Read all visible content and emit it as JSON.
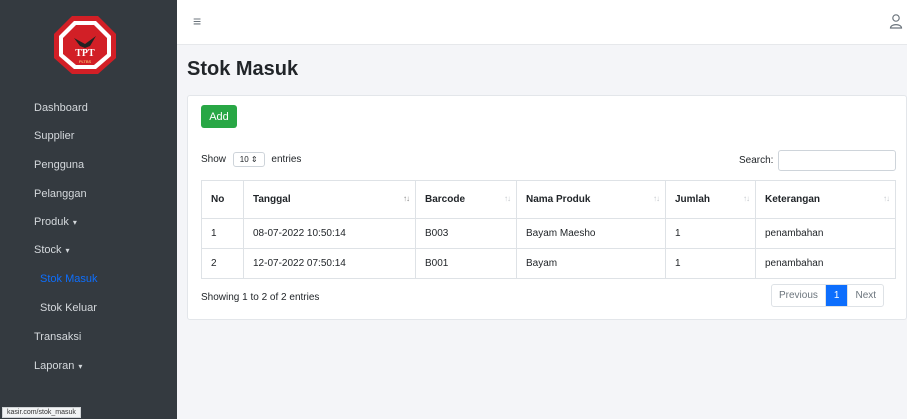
{
  "logo": {
    "text": "TPT",
    "subtext": "PLTBS"
  },
  "sidebar": {
    "items": [
      {
        "label": "Dashboard"
      },
      {
        "label": "Supplier"
      },
      {
        "label": "Pengguna"
      },
      {
        "label": "Pelanggan"
      },
      {
        "label": "Produk",
        "caret": "▾"
      },
      {
        "label": "Stock",
        "caret": "▾"
      },
      {
        "label": "Stok Masuk",
        "active": true
      },
      {
        "label": "Stok Keluar"
      },
      {
        "label": "Transaksi"
      },
      {
        "label": "Laporan",
        "caret": "▾"
      }
    ]
  },
  "topbar": {
    "menu_icon": "≡"
  },
  "page": {
    "title": "Stok Masuk"
  },
  "toolbar": {
    "add_label": "Add"
  },
  "table_controls": {
    "show_label": "Show",
    "entries_value": "10",
    "entries_label": "entries",
    "search_label": "Search:"
  },
  "table": {
    "columns": [
      "No",
      "Tanggal",
      "Barcode",
      "Nama Produk",
      "Jumlah",
      "Keterangan"
    ],
    "rows": [
      [
        "1",
        "08-07-2022 10:50:14",
        "B003",
        "Bayam Maesho",
        "1",
        "penambahan"
      ],
      [
        "2",
        "12-07-2022 07:50:14",
        "B001",
        "Bayam",
        "1",
        "penambahan"
      ]
    ]
  },
  "footer": {
    "info": "Showing 1 to 2 of 2 entries",
    "previous": "Previous",
    "current_page": "1",
    "next": "Next"
  },
  "status_bar": {
    "url": "kasir.com/stok_masuk"
  },
  "colors": {
    "sidebar": "#343a40",
    "primary": "#0d6efd",
    "success": "#28a745"
  }
}
